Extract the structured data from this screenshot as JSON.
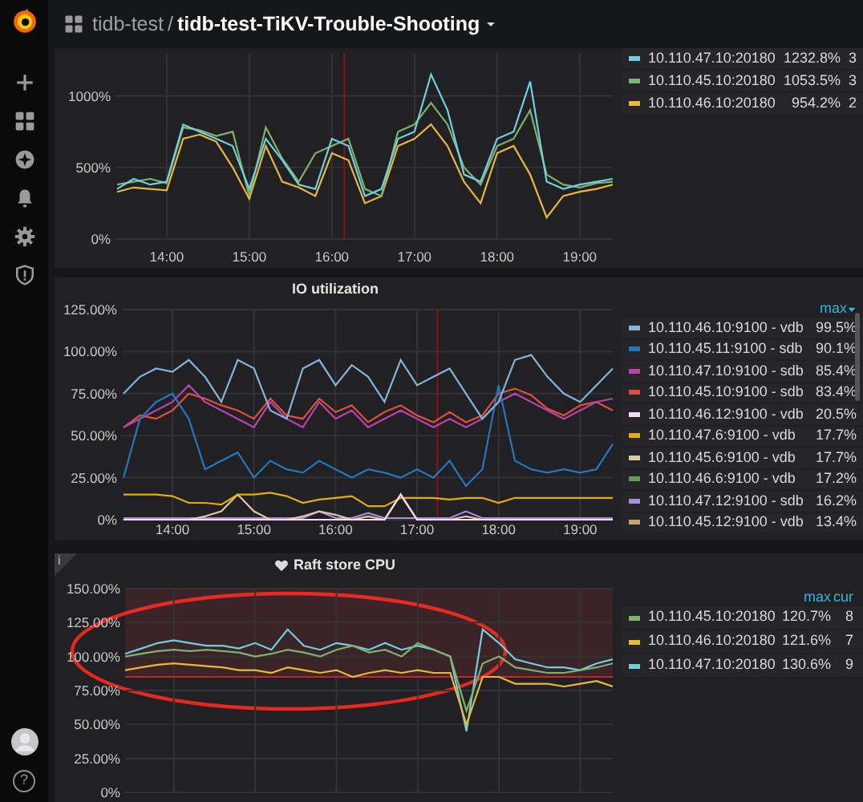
{
  "sidebar": {
    "help_label": "?"
  },
  "breadcrumb": {
    "folder": "tidb-test",
    "separator": "/",
    "dashboard": "tidb-test-TiKV-Trouble-Shooting"
  },
  "panels": [
    {
      "legend": [
        {
          "cells": [
            "1232.8%",
            "3"
          ]
        },
        {
          "cells": [
            "1053.5%",
            "3"
          ]
        },
        {
          "cells": [
            "954.2%",
            "2"
          ]
        }
      ],
      "chart_data": {
        "type": "line",
        "x": [
          13.4,
          13.6,
          13.8,
          14.0,
          14.2,
          14.4,
          14.6,
          14.8,
          15.0,
          15.2,
          15.4,
          15.6,
          15.8,
          16.0,
          16.2,
          16.4,
          16.6,
          16.8,
          17.0,
          17.2,
          17.4,
          17.6,
          17.8,
          18.0,
          18.2,
          18.4,
          18.6,
          18.8,
          19.0,
          19.2,
          19.4
        ],
        "xlim": [
          13.38,
          19.4
        ],
        "ylim": [
          0,
          1300
        ],
        "xticks": [
          {
            "value": 14,
            "label": "14:00"
          },
          {
            "value": 15,
            "label": "15:00"
          },
          {
            "value": 16,
            "label": "16:00"
          },
          {
            "value": 17,
            "label": "17:00"
          },
          {
            "value": 18,
            "label": "18:00"
          },
          {
            "value": 19,
            "label": "19:00"
          }
        ],
        "yticks": [
          {
            "value": 0,
            "label": "0%"
          },
          {
            "value": 500,
            "label": "500%"
          },
          {
            "value": 1000,
            "label": "1000%"
          }
        ],
        "grid": true,
        "ref_lines": [
          {
            "axis": "x",
            "value": 16.15
          }
        ],
        "series": [
          {
            "name": "10.110.47.10:20180",
            "color": "#6ed0e0",
            "values": [
              350,
              420,
              380,
              400,
              800,
              750,
              700,
              650,
              350,
              700,
              550,
              380,
              350,
              700,
              650,
              300,
              350,
              700,
              750,
              1150,
              900,
              450,
              400,
              700,
              750,
              1100,
              400,
              350,
              380,
              400,
              420
            ]
          },
          {
            "name": "10.110.45.10:20180",
            "color": "#7eb26d",
            "values": [
              380,
              400,
              420,
              390,
              780,
              760,
              720,
              750,
              300,
              780,
              560,
              400,
              600,
              650,
              700,
              350,
              300,
              750,
              800,
              950,
              800,
              500,
              380,
              650,
              700,
              900,
              450,
              380,
              360,
              390,
              400
            ]
          },
          {
            "name": "10.110.46.10:20180",
            "color": "#eab839",
            "values": [
              330,
              360,
              350,
              340,
              700,
              730,
              680,
              500,
              280,
              650,
              400,
              360,
              300,
              600,
              550,
              250,
              300,
              650,
              700,
              800,
              650,
              400,
              250,
              600,
              650,
              450,
              150,
              300,
              330,
              350,
              380
            ]
          }
        ]
      }
    },
    {
      "title": "IO utilization",
      "legend_columns": [
        {
          "label": "max",
          "sorted": true
        }
      ],
      "legend": [
        {
          "cells": [
            "99.5%"
          ]
        },
        {
          "cells": [
            "90.1%"
          ]
        },
        {
          "cells": [
            "85.4%"
          ]
        },
        {
          "cells": [
            "83.4%"
          ]
        },
        {
          "cells": [
            "20.5%"
          ]
        },
        {
          "cells": [
            "17.7%"
          ]
        },
        {
          "cells": [
            "17.7%"
          ]
        },
        {
          "cells": [
            "17.2%"
          ]
        },
        {
          "cells": [
            "16.2%"
          ]
        },
        {
          "cells": [
            "13.4%"
          ]
        }
      ],
      "chart_data": {
        "type": "line",
        "x": [
          13.4,
          13.6,
          13.8,
          14.0,
          14.2,
          14.4,
          14.6,
          14.8,
          15.0,
          15.2,
          15.4,
          15.6,
          15.8,
          16.0,
          16.2,
          16.4,
          16.6,
          16.8,
          17.0,
          17.2,
          17.4,
          17.6,
          17.8,
          18.0,
          18.2,
          18.4,
          18.6,
          18.8,
          19.0,
          19.2,
          19.4
        ],
        "xlim": [
          13.38,
          19.4
        ],
        "ylim": [
          0,
          125
        ],
        "xticks": [
          {
            "value": 14,
            "label": "14:00"
          },
          {
            "value": 15,
            "label": "15:00"
          },
          {
            "value": 16,
            "label": "16:00"
          },
          {
            "value": 17,
            "label": "17:00"
          },
          {
            "value": 18,
            "label": "18:00"
          },
          {
            "value": 19,
            "label": "19:00"
          }
        ],
        "yticks": [
          {
            "value": 0,
            "label": "0%"
          },
          {
            "value": 25,
            "label": "25.00%"
          },
          {
            "value": 50,
            "label": "50.00%"
          },
          {
            "value": 75,
            "label": "75.00%"
          },
          {
            "value": 100,
            "label": "100.00%"
          },
          {
            "value": 125,
            "label": "125.00%"
          }
        ],
        "grid": true,
        "ref_lines": [
          {
            "axis": "x",
            "value": 17.25
          }
        ],
        "series": [
          {
            "name": "10.110.46.10:9100 - vdb",
            "color": "#82b5d8",
            "values": [
              75,
              85,
              90,
              88,
              95,
              85,
              70,
              95,
              90,
              65,
              60,
              90,
              95,
              80,
              92,
              85,
              70,
              95,
              80,
              85,
              90,
              75,
              60,
              70,
              95,
              98,
              85,
              75,
              70,
              80,
              90
            ]
          },
          {
            "name": "10.110.45.11:9100 - sdb",
            "color": "#1f78c1",
            "values": [
              25,
              60,
              70,
              75,
              60,
              30,
              35,
              40,
              25,
              35,
              30,
              28,
              35,
              30,
              25,
              30,
              28,
              25,
              30,
              25,
              35,
              20,
              30,
              80,
              35,
              30,
              28,
              30,
              28,
              30,
              45
            ]
          },
          {
            "name": "10.110.47.10:9100 - sdb",
            "color": "#ba43a9",
            "values": [
              55,
              60,
              65,
              70,
              80,
              70,
              65,
              60,
              55,
              70,
              60,
              55,
              70,
              60,
              65,
              55,
              60,
              65,
              60,
              55,
              60,
              55,
              60,
              70,
              75,
              70,
              65,
              60,
              65,
              70,
              72
            ]
          },
          {
            "name": "10.110.45.10:9100 - sdb",
            "color": "#e24d42",
            "values": [
              55,
              62,
              60,
              65,
              75,
              72,
              68,
              65,
              60,
              72,
              62,
              60,
              72,
              64,
              68,
              58,
              64,
              68,
              62,
              58,
              64,
              58,
              62,
              75,
              78,
              74,
              66,
              62,
              68,
              70,
              65
            ]
          },
          {
            "name": "10.110.46.12:9100 - vdb",
            "color": "#f9d9f9",
            "values": [
              0,
              0,
              0,
              0,
              0,
              0,
              0,
              0,
              0,
              0,
              0,
              0,
              0,
              0,
              0,
              0,
              0,
              15,
              0,
              0,
              0,
              0,
              0,
              0,
              0,
              0,
              0,
              0,
              0,
              0,
              0
            ]
          },
          {
            "name": "10.110.47.6:9100 - vdb",
            "color": "#e5ac0e",
            "values": [
              15,
              15,
              15,
              14,
              10,
              10,
              9,
              15,
              15,
              16,
              14,
              10,
              12,
              13,
              14,
              8,
              8,
              13,
              13,
              13,
              12,
              13,
              13,
              10,
              13,
              13,
              13,
              13,
              13,
              13,
              13
            ]
          },
          {
            "name": "10.110.45.6:9100 - vdb",
            "color": "#e0c9a6",
            "values": [
              null,
              null,
              null,
              0,
              0,
              2,
              5,
              15,
              5,
              0,
              0,
              2,
              5,
              3,
              0,
              2,
              0,
              15,
              0,
              0,
              0,
              2,
              0,
              0,
              null,
              null,
              null,
              null,
              null,
              null,
              null
            ]
          },
          {
            "name": "10.110.46.6:9100 - vdb",
            "color": "#629e51",
            "values": [
              null,
              null,
              null,
              null,
              null,
              null,
              null,
              null,
              null,
              null,
              null,
              null,
              null,
              null,
              null,
              null,
              null,
              null,
              null,
              null,
              null,
              null,
              null,
              null,
              null,
              null,
              null,
              null,
              null,
              null,
              null
            ]
          },
          {
            "name": "10.110.47.12:9100 - sdb",
            "color": "#a68ee0",
            "values": [
              1,
              1,
              1,
              1,
              1,
              1,
              1,
              1,
              1,
              1,
              1,
              1,
              5,
              1,
              1,
              4,
              1,
              1,
              1,
              1,
              1,
              5,
              1,
              1,
              1,
              1,
              1,
              1,
              1,
              1,
              1
            ]
          },
          {
            "name": "10.110.45.12:9100 - vdb",
            "color": "#c4a66a",
            "values": [
              null,
              null,
              null,
              null,
              null,
              null,
              null,
              null,
              null,
              null,
              null,
              null,
              null,
              null,
              null,
              null,
              null,
              null,
              null,
              null,
              null,
              null,
              null,
              null,
              null,
              null,
              null,
              null,
              null,
              null,
              null
            ]
          }
        ]
      }
    },
    {
      "title": "Raft store CPU",
      "alert": true,
      "info_marker": "i",
      "legend_columns": [
        {
          "label": "max"
        },
        {
          "label": "cur"
        }
      ],
      "legend": [
        {
          "cells": [
            "120.7%",
            "8"
          ]
        },
        {
          "cells": [
            "121.6%",
            "7"
          ]
        },
        {
          "cells": [
            "130.6%",
            "9"
          ]
        }
      ],
      "chart_data": {
        "type": "line",
        "categories": [
          null,
          null,
          null,
          null,
          null,
          null,
          null,
          null,
          null,
          null,
          null,
          null,
          null,
          null,
          null,
          null,
          null,
          null,
          null,
          null,
          null,
          null,
          null,
          null,
          null,
          null,
          null,
          null,
          null,
          null,
          null
        ],
        "ylim": [
          0,
          150
        ],
        "yticks": [
          {
            "value": 0,
            "label": "0%"
          },
          {
            "value": 25,
            "label": "25.00%"
          },
          {
            "value": 50,
            "label": "50.00%"
          },
          {
            "value": 75,
            "label": "75.00%"
          },
          {
            "value": 100,
            "label": "100.00%"
          },
          {
            "value": 125,
            "label": "125.00%"
          },
          {
            "value": 150,
            "label": "150.00%"
          }
        ],
        "grid": true,
        "bands": [
          {
            "axis": "y",
            "from": 85,
            "to": 150
          }
        ],
        "ref_lines": [
          {
            "axis": "y",
            "value": 85
          }
        ],
        "series": [
          {
            "name": "10.110.45.10:20180",
            "color": "#7eb26d",
            "values": [
              100,
              102,
              104,
              105,
              104,
              105,
              104,
              103,
              100,
              102,
              105,
              103,
              100,
              105,
              108,
              103,
              105,
              100,
              110,
              105,
              100,
              60,
              95,
              100,
              92,
              90,
              88,
              88,
              90,
              92,
              95
            ]
          },
          {
            "name": "10.110.46.10:20180",
            "color": "#eab839",
            "values": [
              90,
              92,
              94,
              95,
              94,
              93,
              92,
              90,
              90,
              88,
              92,
              90,
              88,
              90,
              85,
              88,
              90,
              88,
              90,
              88,
              88,
              50,
              85,
              85,
              80,
              80,
              80,
              78,
              80,
              82,
              78
            ]
          },
          {
            "name": "10.110.47.10:20180",
            "color": "#6ed0e0",
            "values": [
              102,
              106,
              110,
              112,
              110,
              108,
              108,
              106,
              110,
              105,
              120,
              108,
              105,
              110,
              108,
              105,
              110,
              105,
              108,
              105,
              100,
              45,
              120,
              110,
              98,
              95,
              92,
              92,
              90,
              95,
              98
            ]
          }
        ]
      }
    }
  ]
}
